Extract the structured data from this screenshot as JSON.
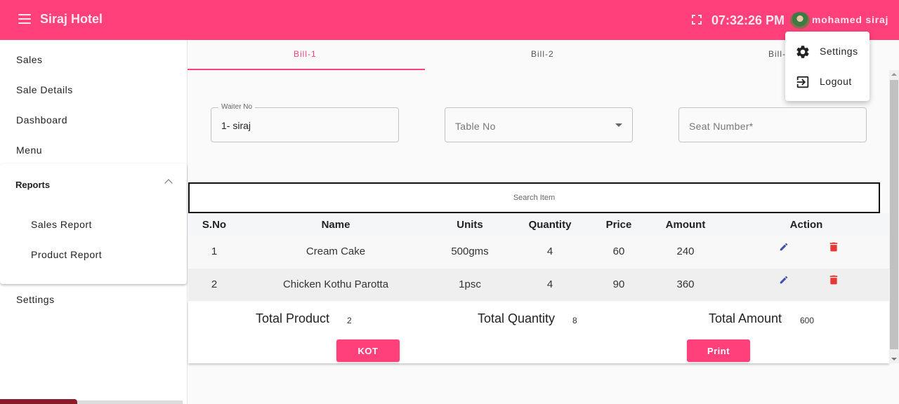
{
  "header": {
    "app_title": "Siraj Hotel",
    "clock": "07:32:26 PM",
    "username": "mohamed siraj",
    "brand_color": "#ff407b"
  },
  "user_menu": {
    "items": [
      {
        "label": "Settings",
        "icon": "gear-icon"
      },
      {
        "label": "Logout",
        "icon": "logout-icon"
      }
    ]
  },
  "sidebar": {
    "items": [
      {
        "label": "Sales"
      },
      {
        "label": "Sale Details"
      },
      {
        "label": "Dashboard"
      },
      {
        "label": "Menu"
      }
    ],
    "reports": {
      "label": "Reports",
      "expanded": true,
      "children": [
        {
          "label": "Sales Report"
        },
        {
          "label": "Product Report"
        }
      ]
    },
    "settings_label": "Settings"
  },
  "tabs": [
    {
      "label": "Bill-1",
      "active": true
    },
    {
      "label": "Bill-2",
      "active": false
    },
    {
      "label": "Bill-3",
      "active": false
    }
  ],
  "form": {
    "waiter": {
      "label": "Waiter No",
      "value": "1- siraj"
    },
    "table": {
      "placeholder": "Table No"
    },
    "seat": {
      "placeholder": "Seat Number*"
    }
  },
  "search": {
    "placeholder": "Search Item"
  },
  "table": {
    "headers": [
      "S.No",
      "Name",
      "Units",
      "Quantity",
      "Price",
      "Amount",
      "Action"
    ],
    "rows": [
      {
        "sno": "1",
        "name": "Cream Cake",
        "units": "500gms",
        "quantity": "4",
        "price": "60",
        "amount": "240"
      },
      {
        "sno": "2",
        "name": "Chicken Kothu Parotta",
        "units": "1psc",
        "quantity": "4",
        "price": "90",
        "amount": "360"
      }
    ]
  },
  "totals": {
    "product_label": "Total Product",
    "product_value": "2",
    "quantity_label": "Total Quantity",
    "quantity_value": "8",
    "amount_label": "Total Amount",
    "amount_value": "600"
  },
  "buttons": {
    "kot": "KOT",
    "print": "Print"
  }
}
